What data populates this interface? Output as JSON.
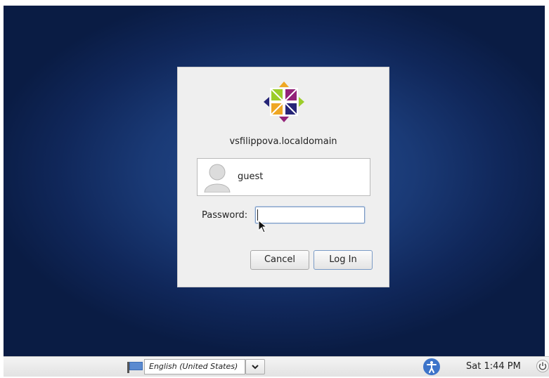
{
  "login": {
    "hostname": "vsfilippova.localdomain",
    "user": "guest",
    "password_label": "Password:",
    "password_value": "",
    "cancel_label": "Cancel",
    "login_label": "Log In"
  },
  "taskbar": {
    "language": "English (United States)",
    "clock": "Sat  1:44 PM"
  },
  "icons": {
    "logo": "centos-logo-icon",
    "avatar": "user-avatar-icon",
    "flag": "language-flag-icon",
    "dropdown": "chevron-down-icon",
    "accessibility": "accessibility-icon",
    "power": "power-icon"
  },
  "colors": {
    "desktop_bg": "#1a3a76",
    "dialog_bg": "#efefef",
    "focus_border": "#7e9ac0"
  }
}
